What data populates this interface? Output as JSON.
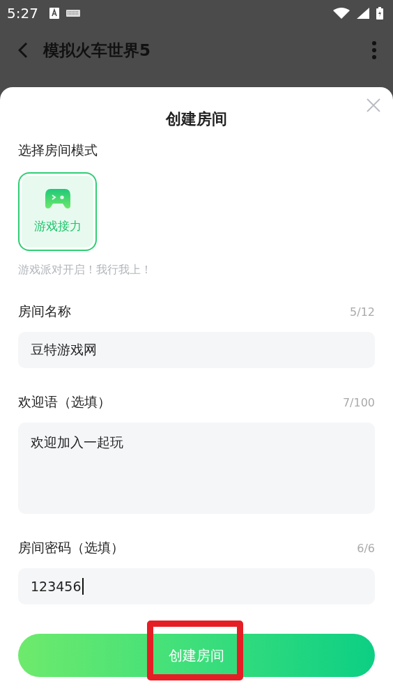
{
  "status_bar": {
    "time": "5:27"
  },
  "header": {
    "title": "模拟火车世界5"
  },
  "sheet": {
    "title": "创建房间",
    "mode_label": "选择房间模式",
    "modes": [
      {
        "label": "游戏接力",
        "selected": true
      }
    ],
    "mode_hint": "游戏派对开启！我行我上！",
    "fields": [
      {
        "kind": "input",
        "label": "房间名称",
        "count": "5/12",
        "value": "豆特游戏网",
        "focused": false
      },
      {
        "kind": "textarea",
        "label": "欢迎语（选填）",
        "count": "7/100",
        "value": "欢迎加入一起玩",
        "focused": false
      },
      {
        "kind": "input",
        "label": "房间密码（选填）",
        "count": "6/6",
        "value": "123456",
        "focused": true
      }
    ],
    "submit": {
      "label": "创建房间",
      "highlighted": true
    }
  }
}
